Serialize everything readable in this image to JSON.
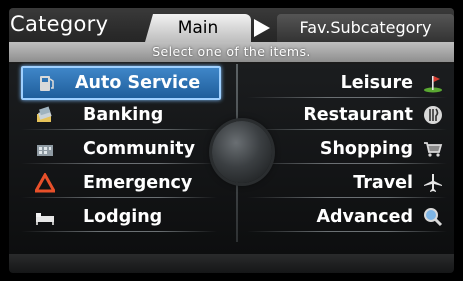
{
  "header": {
    "title": "Category",
    "tabs": [
      {
        "label": "Main",
        "active": true
      },
      {
        "label": "Fav.Subcategory",
        "active": false
      }
    ],
    "subtitle": "Select one of the items."
  },
  "left_items": [
    {
      "label": "Auto Service",
      "icon": "gas-pump-icon",
      "selected": true
    },
    {
      "label": "Banking",
      "icon": "banking-icon",
      "selected": false
    },
    {
      "label": "Community",
      "icon": "community-icon",
      "selected": false
    },
    {
      "label": "Emergency",
      "icon": "emergency-triangle-icon",
      "selected": false
    },
    {
      "label": "Lodging",
      "icon": "bed-icon",
      "selected": false
    }
  ],
  "right_items": [
    {
      "label": "Leisure",
      "icon": "golf-flag-icon"
    },
    {
      "label": "Restaurant",
      "icon": "fork-knife-icon"
    },
    {
      "label": "Shopping",
      "icon": "shopping-cart-icon"
    },
    {
      "label": "Travel",
      "icon": "airplane-icon"
    },
    {
      "label": "Advanced",
      "icon": "magnifier-icon"
    }
  ],
  "colors": {
    "selected_fill": "#2f75b6",
    "selected_border": "#9fd0ff",
    "emergency": "#e8502a",
    "leisure_flag": "#d63b2f",
    "grass": "#5aa832"
  }
}
